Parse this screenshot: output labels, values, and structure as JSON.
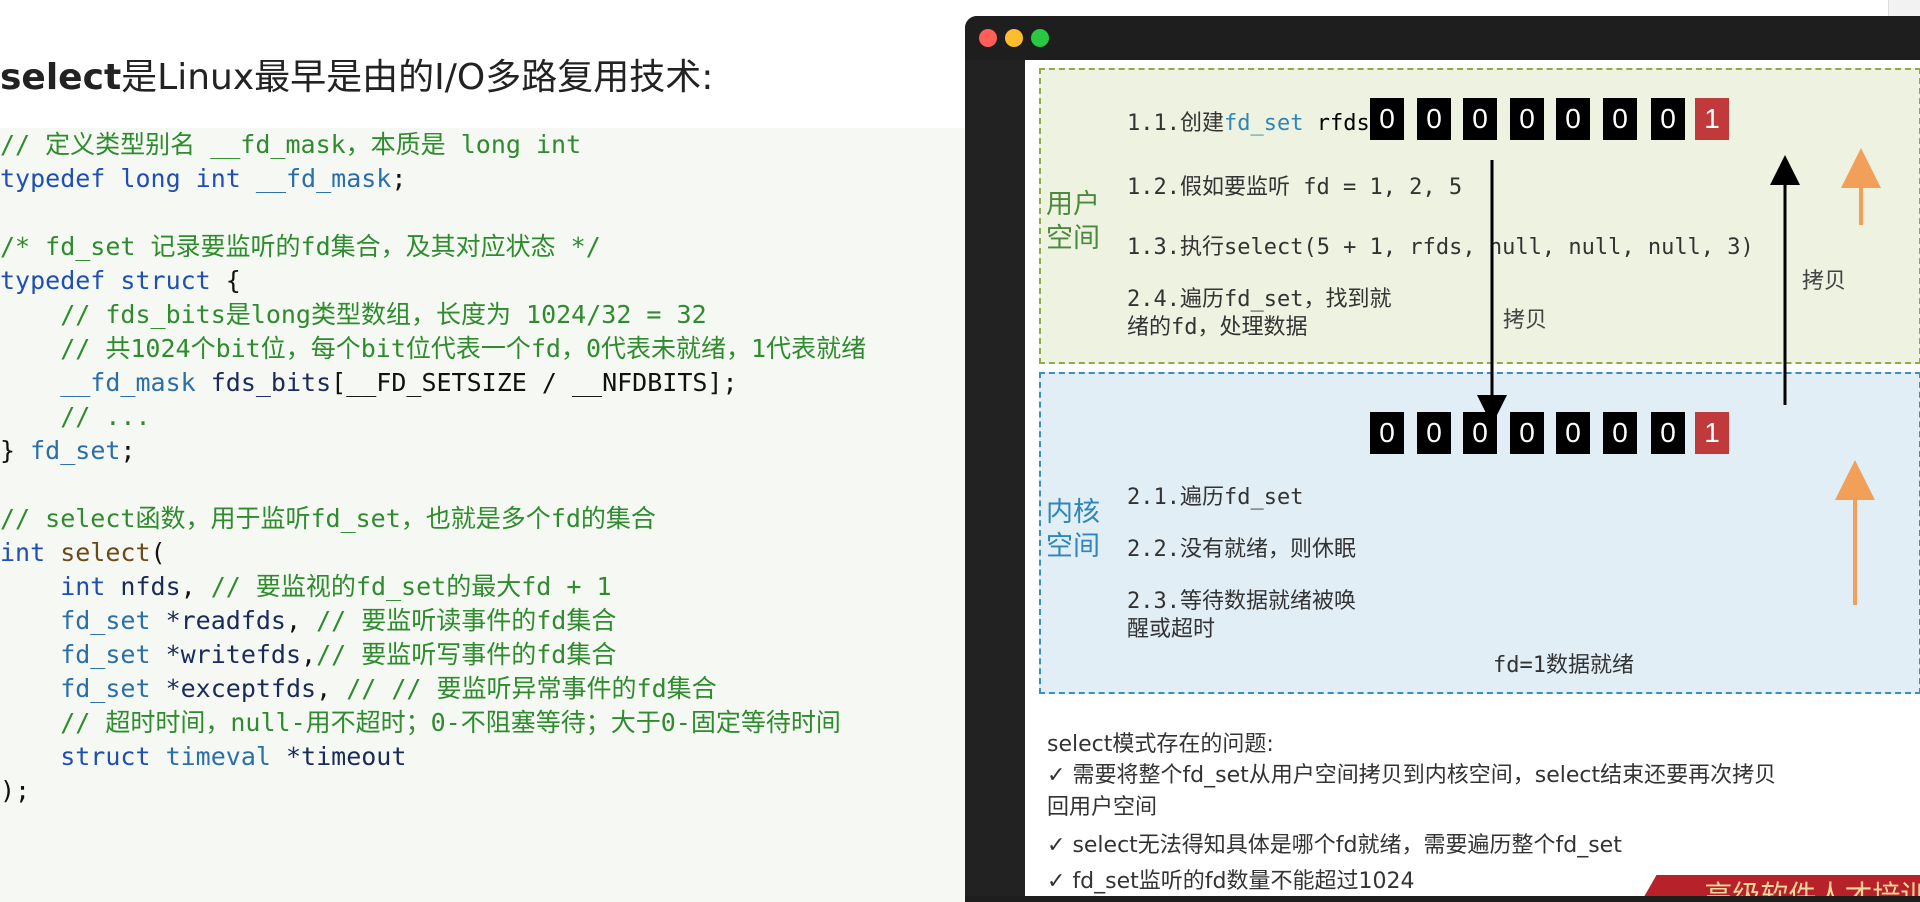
{
  "heading": {
    "bold": "select",
    "rest": "是Linux最早是由的I/O多路复用技术:"
  },
  "code": {
    "l1": "// 定义类型别名 __fd_mask，本质是 long int",
    "l2_kw": "typedef long int",
    "l2_id": "__fd_mask",
    "l2_end": ";",
    "l4": "/* fd_set 记录要监听的fd集合，及其对应状态 */",
    "l5_kw": "typedef struct",
    "l5_end": " {",
    "l6": "    // fds_bits是long类型数组，长度为 1024/32 = 32",
    "l7": "    // 共1024个bit位，每个bit位代表一个fd，0代表未就绪，1代表就绪",
    "l8_ty": "    __fd_mask",
    "l8_id": " fds_bits",
    "l8_end": "[__FD_SETSIZE / __NFDBITS];",
    "l9": "    // ...",
    "l10_a": "} ",
    "l10_ty": "fd_set",
    "l10_end": ";",
    "l12": "// select函数，用于监听fd_set，也就是多个fd的集合",
    "l13_kw": "int",
    "l13_fn": " select",
    "l13_end": "(",
    "l14_kw": "    int",
    "l14_id": " nfds",
    "l14_end": ",",
    "l14_cm": " // 要监视的fd_set的最大fd + 1",
    "l15_ty": "    fd_set",
    "l15_id": " *readfds",
    "l15_end": ",",
    "l15_cm": " // 要监听读事件的fd集合",
    "l16_ty": "    fd_set",
    "l16_id": " *writefds",
    "l16_end": ",",
    "l16_cm": "// 要监听写事件的fd集合",
    "l17_ty": "    fd_set",
    "l17_id": " *exceptfds",
    "l17_end": ",",
    "l17_cm": " // // 要监听异常事件的fd集合",
    "l18": "    // 超时时间，null-用不超时；0-不阻塞等待；大于0-固定等待时间",
    "l19_kw": "    struct",
    "l19_ty": " timeval",
    "l19_id": " *timeout",
    "l20": ");"
  },
  "diagram": {
    "user_zone": "用户\n空间",
    "kernel_zone": "内核\n空间",
    "step_1_1_a": "1.1.创建",
    "step_1_1_b": "fd_set",
    "step_1_1_c": " rfds",
    "step_1_2": "1.2.假如要监听 fd = 1, 2, 5",
    "step_1_3": "1.3.执行select(5 + 1, rfds, null, null, null, 3)",
    "step_2_4": "2.4.遍历fd_set，找到就\n绪的fd，处理数据",
    "step_2_1": "2.1.遍历fd_set",
    "step_2_2": "2.2.没有就绪，则休眠",
    "step_2_3": "2.3.等待数据就绪被唤\n醒或超时",
    "ready_note": "fd=1数据就绪",
    "copy_down": "拷贝",
    "copy_up": "拷贝",
    "user_bits": [
      "0",
      "0",
      "0",
      "0",
      "0",
      "0",
      "0",
      "1"
    ],
    "kernel_bits": [
      "0",
      "0",
      "0",
      "0",
      "0",
      "0",
      "0",
      "1"
    ],
    "colors": {
      "bit_zero": "#000000",
      "bit_one": "#c0393b",
      "arrow_orange": "#f2a059"
    }
  },
  "problems": {
    "title": "select模式存在的问题:",
    "items": [
      "需要将整个fd_set从用户空间拷贝到内核空间，select结束还要再次拷贝\n回用户空间",
      "select无法得知具体是哪个fd就绪，需要遍历整个fd_set",
      "fd_set监听的fd数量不能超过1024"
    ],
    "check": "✓"
  },
  "banner": {
    "text": "高级软件人才培训"
  }
}
